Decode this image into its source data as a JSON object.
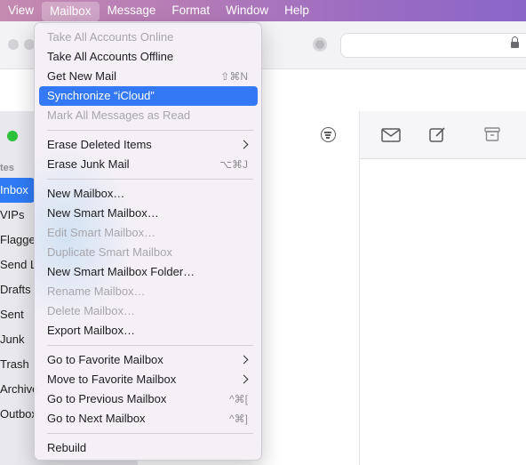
{
  "menubar": {
    "items": [
      "View",
      "Mailbox",
      "Message",
      "Format",
      "Window",
      "Help"
    ],
    "active": "Mailbox"
  },
  "sidebar": {
    "section": "tes",
    "items": [
      "Inbox",
      "VIPs",
      "Flagge",
      "Send L",
      "Drafts",
      "Sent",
      "Junk",
      "Trash",
      "Archive",
      "Outbox"
    ]
  },
  "mailbox_menu": {
    "items": [
      {
        "label": "Take All Accounts Online",
        "enabled": false
      },
      {
        "label": "Take All Accounts Offline",
        "enabled": true
      },
      {
        "label": "Get New Mail",
        "shortcut": "⇧⌘N",
        "enabled": true
      },
      {
        "label": "Synchronize “iCloud”",
        "enabled": true,
        "highlighted": true
      },
      {
        "label": "Mark All Messages as Read",
        "enabled": false
      },
      {
        "label": "Erase Deleted Items",
        "submenu": true,
        "enabled": true
      },
      {
        "label": "Erase Junk Mail",
        "shortcut": "⌥⌘J",
        "enabled": true
      },
      {
        "label": "New Mailbox…",
        "enabled": true
      },
      {
        "label": "New Smart Mailbox…",
        "enabled": true
      },
      {
        "label": "Edit Smart Mailbox…",
        "enabled": false
      },
      {
        "label": "Duplicate Smart Mailbox",
        "enabled": false
      },
      {
        "label": "New Smart Mailbox Folder…",
        "enabled": true
      },
      {
        "label": "Rename Mailbox…",
        "enabled": false
      },
      {
        "label": "Delete Mailbox…",
        "enabled": false
      },
      {
        "label": "Export Mailbox…",
        "enabled": true
      },
      {
        "label": "Go to Favorite Mailbox",
        "submenu": true,
        "enabled": true
      },
      {
        "label": "Move to Favorite Mailbox",
        "submenu": true,
        "enabled": true
      },
      {
        "label": "Go to Previous Mailbox",
        "shortcut": "^⌘[",
        "enabled": true
      },
      {
        "label": "Go to Next Mailbox",
        "shortcut": "^⌘]",
        "enabled": true
      },
      {
        "label": "Rebuild",
        "enabled": true
      }
    ]
  },
  "colors": {
    "highlight": "#3478f6",
    "sidebar_selected": "#2f7bf6",
    "status_online": "#2ec13c"
  }
}
